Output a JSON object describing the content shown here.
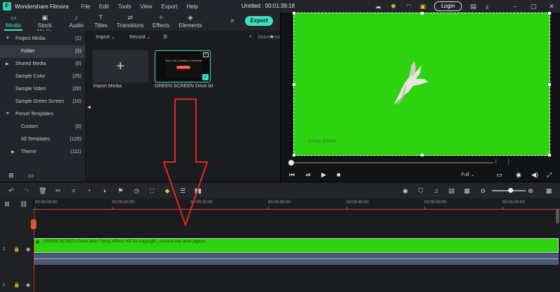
{
  "app": {
    "name": "Wondershare Filmora",
    "logo_char": "F",
    "menu": [
      "File",
      "Edit",
      "Tools",
      "View",
      "Export",
      "Help"
    ],
    "document_title": "Untitled : 00:01:36:18",
    "login_label": "Login",
    "icons": [
      "cloud-icon",
      "bulb-icon",
      "headset-icon",
      "gift-icon",
      "save-icon",
      "download-icon",
      "minimize-icon",
      "maximize-icon",
      "close-icon"
    ]
  },
  "tabs": [
    {
      "label": "Media",
      "icon": "folder-icon",
      "active": true
    },
    {
      "label": "Stock Media",
      "icon": "stock-media-icon"
    },
    {
      "label": "Audio",
      "icon": "audio-icon"
    },
    {
      "label": "Titles",
      "icon": "titles-icon"
    },
    {
      "label": "Transitions",
      "icon": "transitions-icon"
    },
    {
      "label": "Effects",
      "icon": "effects-icon"
    },
    {
      "label": "Elements",
      "icon": "elements-icon"
    }
  ],
  "export_label": "Export",
  "sidebar": {
    "items": [
      {
        "label": "Project Media",
        "count": "(1)",
        "caret": "down"
      },
      {
        "label": "Folder",
        "count": "(1)",
        "selected": true
      },
      {
        "label": "Shared Media",
        "count": "(0)",
        "caret": "right"
      },
      {
        "label": "Sample Color",
        "count": "(25)"
      },
      {
        "label": "Sample Video",
        "count": "(20)"
      },
      {
        "label": "Sample Green Screen",
        "count": "(10)"
      },
      {
        "label": "Preset Templates",
        "count": "",
        "caret": "down"
      },
      {
        "label": "Custom",
        "count": "(0)"
      },
      {
        "label": "All Templates",
        "count": "(120)"
      },
      {
        "label": "Theme",
        "count": "(111)",
        "caret": "right"
      }
    ]
  },
  "media_toolbar": {
    "import_label": "Import",
    "record_label": "Record",
    "search_placeholder": "Search media"
  },
  "media_items": [
    {
      "caption": "Import Media"
    },
    {
      "caption": "GREEN SCREEN Dove bir...",
      "thumb_line1": "Please LIKE, COMMENT & SUBSCRIBE",
      "thumb_badge": "SUBSCRIBE"
    }
  ],
  "preview": {
    "background_color": "#2cd30e",
    "watermark": "Crazy Editor",
    "quality": "Full",
    "subject": "flying white dove"
  },
  "timeline": {
    "ruler_labels": [
      "00:00:00:00",
      "00:00:10:00",
      "00:00:20:00",
      "00:00:30:00",
      "00:00:40:00",
      "00:00:50:00",
      "00:01:00:00"
    ],
    "clip_title": "GREEN SCREEN Dove birds Flying effects HD No copyright  , chroma key dove pigeon",
    "track_video_label": "2",
    "track_audio_label": "1"
  },
  "colors": {
    "accent": "#3ee0c2",
    "playhead": "#e03a3a",
    "green_screen": "#2cd30e",
    "annotation_arrow": "#e0261f"
  }
}
